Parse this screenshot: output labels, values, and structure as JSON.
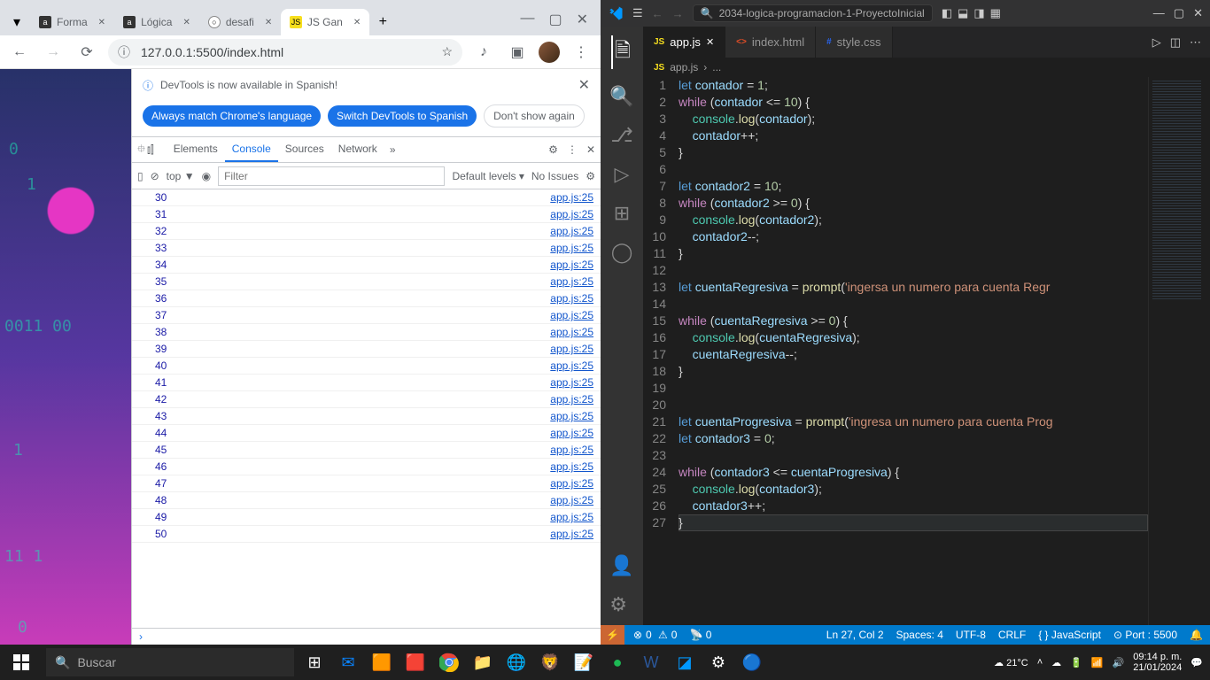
{
  "chrome": {
    "tabs": [
      {
        "label": "Forma",
        "favType": "a"
      },
      {
        "label": "Lógica",
        "favType": "a"
      },
      {
        "label": "desafi",
        "favType": "gh"
      },
      {
        "label": "JS Gan",
        "favType": "js",
        "active": true
      }
    ],
    "url": "127.0.0.1:5500/index.html",
    "devtools": {
      "banner": "DevTools is now available in Spanish!",
      "chip1": "Always match Chrome's language",
      "chip2": "Switch DevTools to Spanish",
      "chip3": "Don't show again",
      "tabs": [
        "Elements",
        "Console",
        "Sources",
        "Network"
      ],
      "filterPlaceholder": "Filter",
      "topLabel": "top ▼",
      "levels": "Default levels ▾",
      "noIssues": "No Issues",
      "logs": [
        30,
        31,
        32,
        33,
        34,
        35,
        36,
        37,
        38,
        39,
        40,
        41,
        42,
        43,
        44,
        45,
        46,
        47,
        48,
        49,
        50
      ],
      "logSrc": "app.js:25"
    }
  },
  "vscode": {
    "searchText": "2034-logica-programacion-1-ProyectoInicial",
    "tabs": [
      {
        "icon": "js",
        "label": "app.js",
        "active": true,
        "dirty": false
      },
      {
        "icon": "html",
        "label": "index.html"
      },
      {
        "icon": "css",
        "label": "style.css"
      }
    ],
    "breadcrumb": {
      "icon": "js",
      "file": "app.js",
      "sep": "›",
      "rest": "..."
    },
    "code": [
      {
        "n": 1,
        "html": "<span class='kw2'>let</span> <span class='var'>contador</span> <span class='op'>=</span> <span class='num'>1</span><span class='pn'>;</span>"
      },
      {
        "n": 2,
        "html": "<span class='kw'>while</span> <span class='pn'>(</span><span class='var'>contador</span> <span class='op'>&lt;=</span> <span class='num'>10</span><span class='pn'>) {</span>"
      },
      {
        "n": 3,
        "html": "    <span class='obj'>console</span><span class='pn'>.</span><span class='fn'>log</span><span class='pn'>(</span><span class='var'>contador</span><span class='pn'>);</span>"
      },
      {
        "n": 4,
        "html": "    <span class='var'>contador</span><span class='op'>++</span><span class='pn'>;</span>"
      },
      {
        "n": 5,
        "html": "<span class='pn'>}</span>"
      },
      {
        "n": 6,
        "html": ""
      },
      {
        "n": 7,
        "html": "<span class='kw2'>let</span> <span class='var'>contador2</span> <span class='op'>=</span> <span class='num'>10</span><span class='pn'>;</span>"
      },
      {
        "n": 8,
        "html": "<span class='kw'>while</span> <span class='pn'>(</span><span class='var'>contador2</span> <span class='op'>&gt;=</span> <span class='num'>0</span><span class='pn'>) {</span>"
      },
      {
        "n": 9,
        "html": "    <span class='obj'>console</span><span class='pn'>.</span><span class='fn'>log</span><span class='pn'>(</span><span class='var'>contador2</span><span class='pn'>);</span>"
      },
      {
        "n": 10,
        "html": "    <span class='var'>contador2</span><span class='op'>--</span><span class='pn'>;</span>"
      },
      {
        "n": 11,
        "html": "<span class='pn'>}</span>"
      },
      {
        "n": 12,
        "html": ""
      },
      {
        "n": 13,
        "html": "<span class='kw2'>let</span> <span class='var'>cuentaRegresiva</span> <span class='op'>=</span> <span class='fn'>prompt</span><span class='pn'>(</span><span class='str'>'ingersa un numero para cuenta Regr</span>"
      },
      {
        "n": 14,
        "html": ""
      },
      {
        "n": 15,
        "html": "<span class='kw'>while</span> <span class='pn'>(</span><span class='var'>cuentaRegresiva</span> <span class='op'>&gt;=</span> <span class='num'>0</span><span class='pn'>) {</span>"
      },
      {
        "n": 16,
        "html": "    <span class='obj'>console</span><span class='pn'>.</span><span class='fn'>log</span><span class='pn'>(</span><span class='var'>cuentaRegresiva</span><span class='pn'>);</span>"
      },
      {
        "n": 17,
        "html": "    <span class='var'>cuentaRegresiva</span><span class='op'>--</span><span class='pn'>;</span>"
      },
      {
        "n": 18,
        "html": "<span class='pn'>}</span>"
      },
      {
        "n": 19,
        "html": ""
      },
      {
        "n": 20,
        "html": ""
      },
      {
        "n": 21,
        "html": "<span class='kw2'>let</span> <span class='var'>cuentaProgresiva</span> <span class='op'>=</span> <span class='fn'>prompt</span><span class='pn'>(</span><span class='str'>'ingresa un numero para cuenta Prog</span>"
      },
      {
        "n": 22,
        "html": "<span class='kw2'>let</span> <span class='var'>contador3</span> <span class='op'>=</span> <span class='num'>0</span><span class='pn'>;</span>"
      },
      {
        "n": 23,
        "html": ""
      },
      {
        "n": 24,
        "html": "<span class='kw'>while</span> <span class='pn'>(</span><span class='var'>contador3</span> <span class='op'>&lt;=</span> <span class='var'>cuentaProgresiva</span><span class='pn'>) {</span>"
      },
      {
        "n": 25,
        "html": "    <span class='obj'>console</span><span class='pn'>.</span><span class='fn'>log</span><span class='pn'>(</span><span class='var'>contador3</span><span class='pn'>);</span>"
      },
      {
        "n": 26,
        "html": "    <span class='var'>contador3</span><span class='op'>++</span><span class='pn'>;</span>"
      },
      {
        "n": 27,
        "html": "<span class='pn'>}</span>"
      }
    ],
    "cursorLine": 27,
    "status": {
      "errors": "0",
      "warnings": "0",
      "port0": "0",
      "pos": "Ln 27, Col 2",
      "spaces": "Spaces: 4",
      "enc": "UTF-8",
      "eol": "CRLF",
      "lang": "JavaScript",
      "port": "Port : 5500"
    }
  },
  "taskbar": {
    "searchPlaceholder": "Buscar",
    "weather": "21°C",
    "time": "09:14 p. m.",
    "date": "21/01/2024"
  }
}
